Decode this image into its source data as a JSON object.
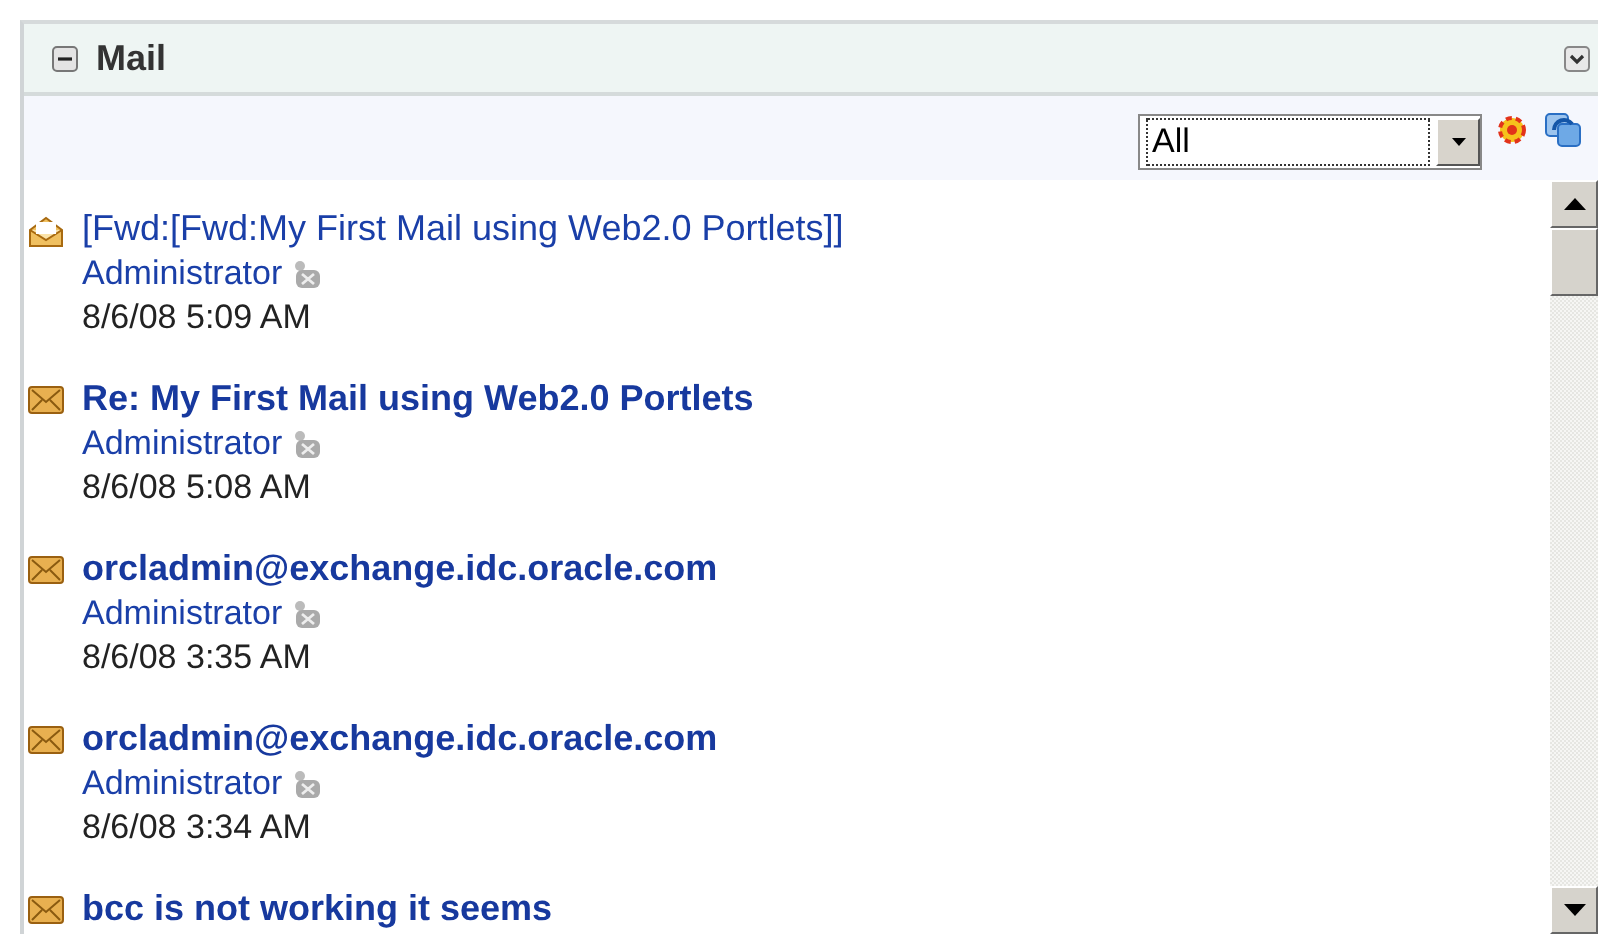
{
  "portlet": {
    "title": "Mail",
    "expanded": true
  },
  "toolbar": {
    "filter": {
      "value": "All"
    }
  },
  "messages": [
    {
      "subject": "[Fwd:[Fwd:My First Mail using Web2.0 Portlets]]",
      "sender": "Administrator",
      "date": "8/6/08 5:09 AM",
      "read": true
    },
    {
      "subject": "Re: My First Mail using Web2.0 Portlets",
      "sender": "Administrator",
      "date": "8/6/08 5:08 AM",
      "read": false
    },
    {
      "subject": "orcladmin@exchange.idc.oracle.com",
      "sender": "Administrator",
      "date": "8/6/08 3:35 AM",
      "read": false
    },
    {
      "subject": "orcladmin@exchange.idc.oracle.com",
      "sender": "Administrator",
      "date": "8/6/08 3:34 AM",
      "read": false
    },
    {
      "subject": "bcc is not working it seems",
      "read": false
    }
  ]
}
